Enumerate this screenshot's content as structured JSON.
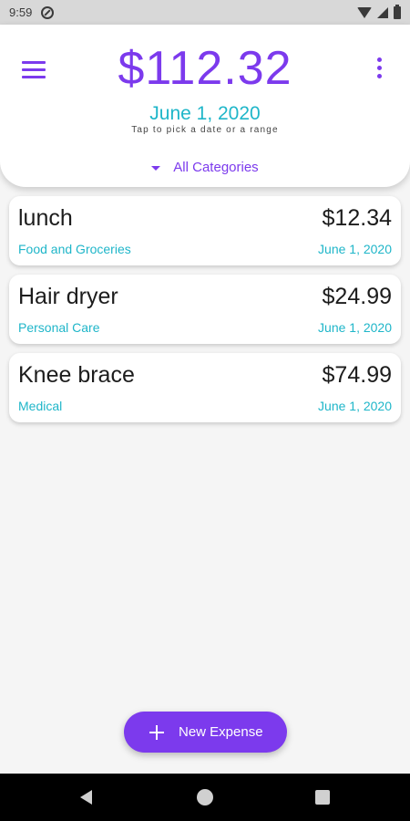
{
  "status_bar": {
    "time": "9:59"
  },
  "header": {
    "total": "$112.32",
    "date": "June 1, 2020",
    "hint": "Tap to pick a date or a range",
    "category_filter": "All Categories"
  },
  "expenses": [
    {
      "name": "lunch",
      "amount": "$12.34",
      "category": "Food and Groceries",
      "date": "June 1, 2020"
    },
    {
      "name": "Hair dryer",
      "amount": "$24.99",
      "category": "Personal Care",
      "date": "June 1, 2020"
    },
    {
      "name": "Knee brace",
      "amount": "$74.99",
      "category": "Medical",
      "date": "June 1, 2020"
    }
  ],
  "fab": {
    "label": "New Expense",
    "icon": "plus-icon"
  },
  "icons": {
    "menu": "menu-icon",
    "more": "more-vert-icon",
    "dropdown": "caret-down-icon"
  },
  "colors": {
    "primary": "#7c3aed",
    "accent": "#1fb6c9",
    "background": "#f5f5f5"
  }
}
